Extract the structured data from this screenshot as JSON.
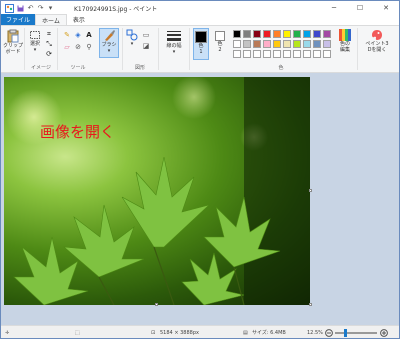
{
  "titlebar": {
    "title": "K170924991S.jpg - ペイント",
    "quick_access": [
      "save-icon",
      "undo-icon",
      "redo-icon",
      "dropdown-icon"
    ],
    "minimize": "─",
    "maximize": "☐",
    "close": "✕"
  },
  "tabs": {
    "file": "ファイル",
    "home": "ホーム",
    "view": "表示"
  },
  "ribbon": {
    "clipboard": {
      "paste_label": "クリップ\nボード",
      "group": ""
    },
    "image": {
      "select_label": "選択",
      "group": "イメージ"
    },
    "tools": {
      "group": "ツール"
    },
    "brushes": {
      "label": "ブラシ"
    },
    "shapes": {
      "label": "図形",
      "group": "図形"
    },
    "line_width": {
      "label": "線の幅"
    },
    "color1": {
      "label": "色\n1"
    },
    "color2": {
      "label": "色\n2"
    },
    "colors_group": "色",
    "edit_colors": {
      "label": "色の\n編集"
    },
    "paint3d": {
      "label": "ペイント3\nDを開く"
    },
    "palette_row1": [
      "#000000",
      "#7f7f7f",
      "#880015",
      "#ed1c24",
      "#ff7f27",
      "#fff200",
      "#22b14c",
      "#00a2e8",
      "#3f48cc",
      "#a349a4"
    ],
    "palette_row2": [
      "#ffffff",
      "#c3c3c3",
      "#b97a57",
      "#ffaec9",
      "#ffc90e",
      "#efe4b0",
      "#b5e61d",
      "#99d9ea",
      "#7092be",
      "#c8bfe7"
    ]
  },
  "canvas": {
    "overlay_text": "画像を開く"
  },
  "statusbar": {
    "dimensions": "5184 × 3888px",
    "size": "サイズ: 6.4MB",
    "zoom": "12.5%",
    "zoom_level": 0.22
  }
}
